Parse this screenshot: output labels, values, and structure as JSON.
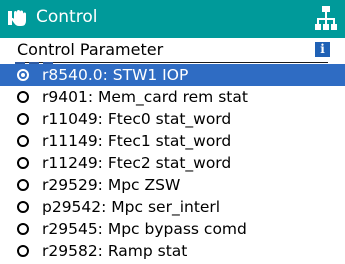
{
  "header": {
    "title": "Control",
    "left_icon": "hand-control-icon",
    "right_icon": "network-tree-icon"
  },
  "subheader": {
    "title": "Control Parameter",
    "info_icon": "info-icon",
    "info_glyph": "i"
  },
  "colors": {
    "header_bg": "#009a9a",
    "selected_bg": "#2f6cc3",
    "info_bg": "#1f61b5"
  },
  "list": {
    "selected_index": 0,
    "items": [
      {
        "label": "r8540.0: STW1 IOP"
      },
      {
        "label": "r9401: Mem_card rem stat"
      },
      {
        "label": "r11049: Ftec0 stat_word"
      },
      {
        "label": "r11149: Ftec1 stat_word"
      },
      {
        "label": "r11249: Ftec2 stat_word"
      },
      {
        "label": "r29529: Mpc ZSW"
      },
      {
        "label": "p29542: Mpc ser_interl"
      },
      {
        "label": "r29545: Mpc bypass comd"
      },
      {
        "label": "r29582: Ramp stat"
      }
    ]
  }
}
